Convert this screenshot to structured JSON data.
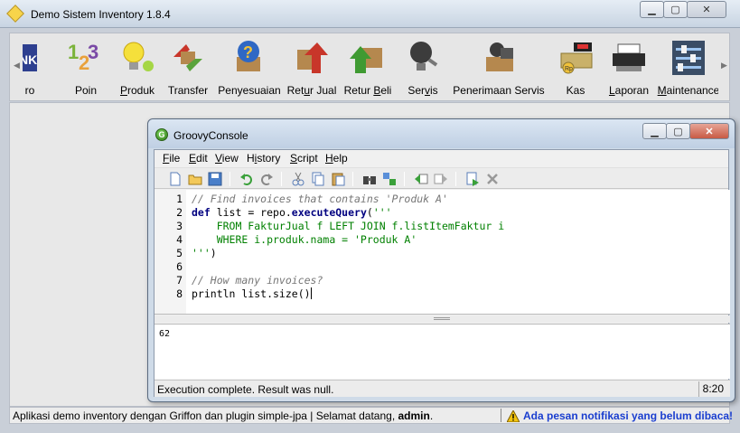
{
  "window": {
    "title": "Demo Sistem Inventory 1.8.4",
    "app_icon": "diamond-app-icon"
  },
  "toolbar": {
    "items": [
      {
        "label": "ro",
        "icon": "truncated-brand-icon"
      },
      {
        "label": "Poin",
        "icon": "numbers-123-icon"
      },
      {
        "label": "Produk",
        "icon": "lightbulb-icon",
        "mnemonic": "P"
      },
      {
        "label": "Transfer",
        "icon": "transfer-arrows-icon"
      },
      {
        "label": "Penyesuaian",
        "icon": "question-box-icon"
      },
      {
        "label": "Retur Jual",
        "icon": "box-arrow-up-red-icon",
        "mnemonic": "u"
      },
      {
        "label": "Retur Beli",
        "icon": "box-arrow-up-green-icon",
        "mnemonic": "B"
      },
      {
        "label": "Servis",
        "icon": "bulb-dark-icon",
        "mnemonic": "v"
      },
      {
        "label": "Penerimaan Servis",
        "icon": "camera-box-icon"
      },
      {
        "label": "Kas",
        "icon": "cash-register-icon"
      },
      {
        "label": "Laporan",
        "icon": "printer-icon",
        "mnemonic": "L"
      },
      {
        "label": "Maintenance",
        "icon": "sliders-icon",
        "mnemonic": "M"
      }
    ]
  },
  "statusbar": {
    "left_text": "Aplikasi demo inventory dengan Griffon dan plugin simple-jpa | Selamat datang,",
    "user": "admin",
    "left_suffix": ".",
    "notification": "Ada pesan notifikasi yang belum dibaca!"
  },
  "console": {
    "title": "GroovyConsole",
    "menus": [
      {
        "label": "File",
        "mnemonic": "F"
      },
      {
        "label": "Edit",
        "mnemonic": "E"
      },
      {
        "label": "View",
        "mnemonic": "V"
      },
      {
        "label": "History",
        "mnemonic": "i"
      },
      {
        "label": "Script",
        "mnemonic": "S"
      },
      {
        "label": "Help",
        "mnemonic": "H"
      }
    ],
    "tool_icons": [
      "new-file-icon",
      "open-folder-icon",
      "save-icon",
      "undo-icon",
      "redo-icon",
      "cut-icon",
      "copy-icon",
      "paste-icon",
      "find-icon",
      "replace-icon",
      "history-previous-icon",
      "history-next-icon",
      "run-script-icon",
      "interrupt-icon"
    ],
    "code_lines": [
      {
        "n": "1",
        "text": "// Find invoices that contains 'Produk A'"
      },
      {
        "n": "2",
        "text": "def list = repo.executeQuery('''"
      },
      {
        "n": "3",
        "text": "    FROM FakturJual f LEFT JOIN f.listItemFaktur i"
      },
      {
        "n": "4",
        "text": "    WHERE i.produk.nama = 'Produk A'"
      },
      {
        "n": "5",
        "text": "''')"
      },
      {
        "n": "6",
        "text": ""
      },
      {
        "n": "7",
        "text": "// How many invoices?"
      },
      {
        "n": "8",
        "text": "println list.size()"
      }
    ],
    "output": "62",
    "status_message": "Execution complete. Result was null.",
    "caret_position": "8:20"
  },
  "colors": {
    "keyword": "#000080",
    "string": "#008000",
    "comment": "#777777",
    "notification": "#1a3ecf"
  }
}
